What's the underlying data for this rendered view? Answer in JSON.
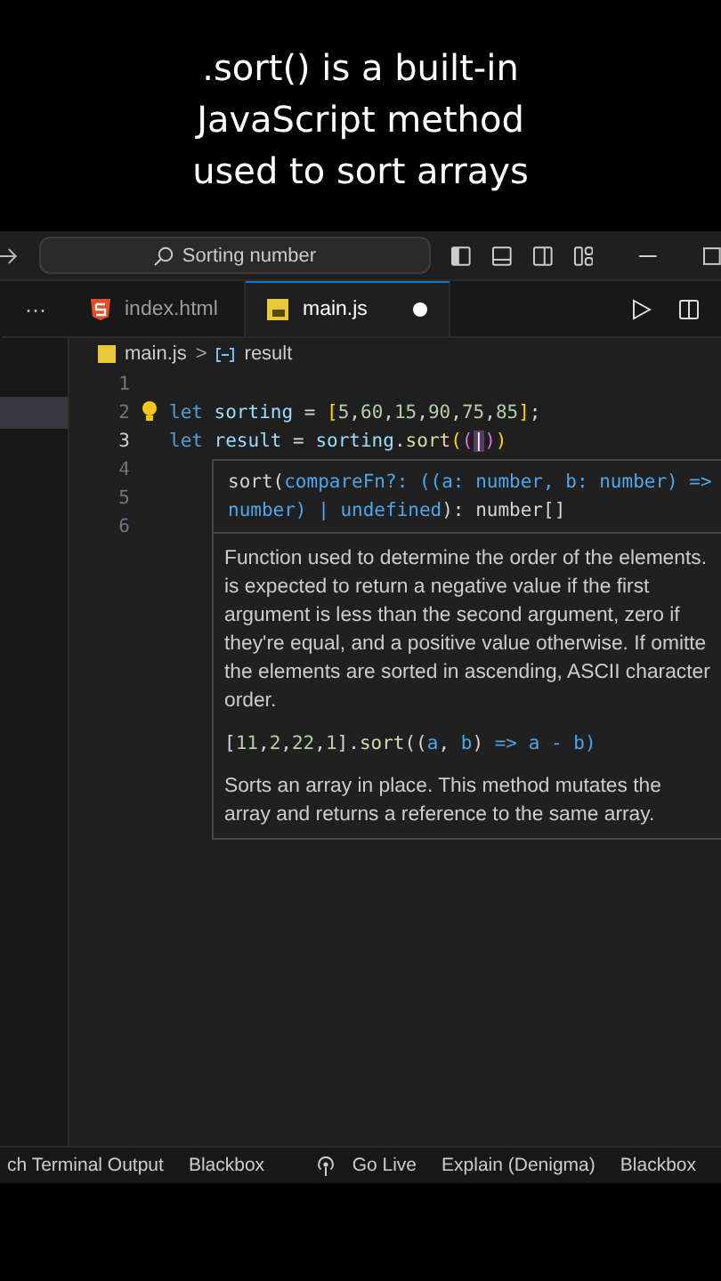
{
  "caption": [
    ".sort() is a built-in",
    "JavaScript method",
    "used to sort arrays"
  ],
  "title_bar": {
    "search": "Sorting number"
  },
  "tabs_bar": {
    "more": "···",
    "tabs": [
      {
        "label": "index.html",
        "kind": "html",
        "selected": false,
        "modified": false
      },
      {
        "label": "main.js",
        "kind": "js",
        "selected": true,
        "modified": true
      }
    ]
  },
  "breadcrumb": {
    "file": "main.js",
    "separator": ">",
    "symbol": "result"
  },
  "editor": {
    "lines": [
      {
        "number": "1",
        "current": false
      },
      {
        "number": "2",
        "current": false,
        "tokens": [
          {
            "text": "let",
            "kind": "keyword"
          },
          {
            "text": " sorting",
            "kind": "variable"
          },
          {
            "text": " = ",
            "kind": "plain"
          },
          {
            "text": "[",
            "kind": "bracket"
          },
          {
            "text": "5",
            "kind": "number"
          },
          {
            "text": ",",
            "kind": "plain"
          },
          {
            "text": "60",
            "kind": "number"
          },
          {
            "text": ",",
            "kind": "plain"
          },
          {
            "text": "15",
            "kind": "number"
          },
          {
            "text": ",",
            "kind": "plain"
          },
          {
            "text": "90",
            "kind": "number"
          },
          {
            "text": ",",
            "kind": "plain"
          },
          {
            "text": "75",
            "kind": "number"
          },
          {
            "text": ",",
            "kind": "plain"
          },
          {
            "text": "85",
            "kind": "number"
          },
          {
            "text": "]",
            "kind": "bracket"
          },
          {
            "text": ";",
            "kind": "plain"
          }
        ]
      },
      {
        "number": "3",
        "current": true,
        "tokens": [
          {
            "text": "let",
            "kind": "keyword"
          },
          {
            "text": " result",
            "kind": "variable"
          },
          {
            "text": " = ",
            "kind": "plain"
          },
          {
            "text": "sorting",
            "kind": "variable"
          },
          {
            "text": ".",
            "kind": "plain"
          },
          {
            "text": "sort",
            "kind": "function"
          },
          {
            "text": "(",
            "kind": "bracket"
          },
          {
            "text": "(",
            "kind": "bracket2"
          },
          {
            "text": "|",
            "kind": "cursor"
          },
          {
            "text": ")",
            "kind": "bracket2"
          },
          {
            "text": ")",
            "kind": "bracket"
          }
        ]
      },
      {
        "number": "4",
        "current": false
      },
      {
        "number": "5",
        "current": false
      },
      {
        "number": "6",
        "current": false
      }
    ]
  },
  "hover": {
    "signature": [
      [
        {
          "text": "sort(",
          "kind": "plain"
        },
        {
          "text": "compareFn?: ((a: number, b: number) =>",
          "kind": "param"
        }
      ],
      [
        {
          "text": "number) | undefined",
          "kind": "param"
        },
        {
          "text": "): number[]",
          "kind": "plain"
        }
      ]
    ],
    "description": [
      "Function used to determine the order of the elements.",
      "is expected to return a negative value if the first",
      "argument is less than the second argument, zero if",
      "they're equal, and a positive value otherwise. If omitte",
      "the elements are sorted in ascending, ASCII character",
      "order."
    ],
    "example": [
      {
        "text": "[",
        "kind": "plain"
      },
      {
        "text": "11",
        "kind": "number"
      },
      {
        "text": ",",
        "kind": "plain"
      },
      {
        "text": "2",
        "kind": "number"
      },
      {
        "text": ",",
        "kind": "plain"
      },
      {
        "text": "22",
        "kind": "number"
      },
      {
        "text": ",",
        "kind": "plain"
      },
      {
        "text": "1",
        "kind": "number"
      },
      {
        "text": "].",
        "kind": "plain"
      },
      {
        "text": "sort",
        "kind": "function"
      },
      {
        "text": "((",
        "kind": "plain"
      },
      {
        "text": "a",
        "kind": "param"
      },
      {
        "text": ", ",
        "kind": "plain"
      },
      {
        "text": "b",
        "kind": "param"
      },
      {
        "text": ") ",
        "kind": "plain"
      },
      {
        "text": "=>",
        "kind": "keyword"
      },
      {
        "text": " a - b)",
        "kind": "param"
      }
    ],
    "note": "Sorts an array in place. This method mutates the array and returns a reference to the same array."
  },
  "status_bar": {
    "left": [
      "ch Terminal Output",
      "Blackbox"
    ],
    "right": [
      {
        "label": "Go Live",
        "kind": "live"
      },
      {
        "label": "Explain (Denigma)",
        "kind": "plain"
      },
      {
        "label": "Blackbox",
        "kind": "plain"
      }
    ]
  }
}
